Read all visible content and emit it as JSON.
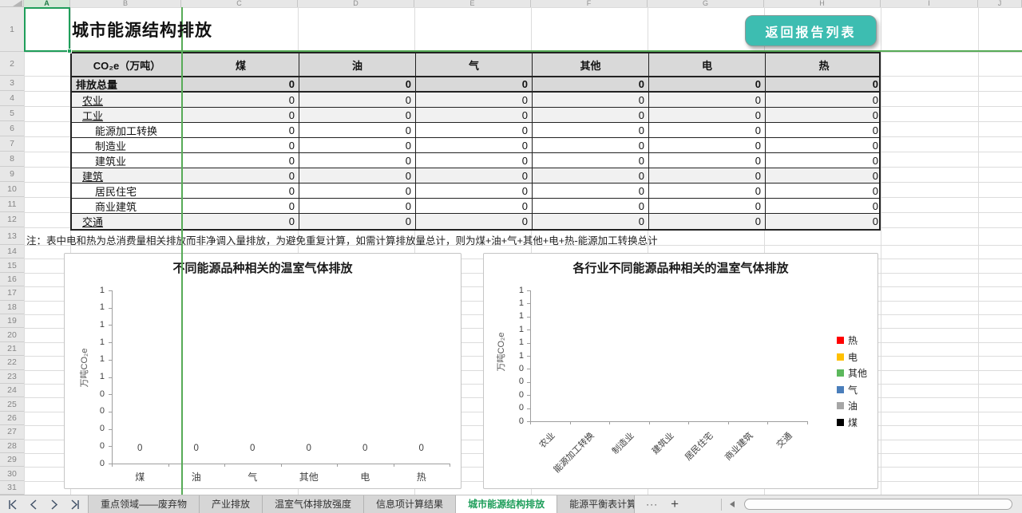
{
  "page": {
    "title": "城市能源结构排放",
    "return_button": "返回报告列表"
  },
  "spreadsheet": {
    "selected_cell": "A1",
    "column_letters": [
      "A",
      "B",
      "C",
      "D",
      "E",
      "F",
      "G",
      "H",
      "I",
      "J"
    ],
    "visible_rows": [
      "1",
      "2",
      "3",
      "4",
      "5",
      "6",
      "7",
      "8",
      "9",
      "10",
      "11",
      "12",
      "13",
      "14",
      "15",
      "16",
      "17",
      "18",
      "19",
      "20",
      "21",
      "22",
      "23",
      "24",
      "25",
      "26",
      "27",
      "28",
      "29",
      "30",
      "31"
    ]
  },
  "table": {
    "headers": [
      "CO₂e（万吨）",
      "煤",
      "油",
      "气",
      "其他",
      "电",
      "热"
    ],
    "rows": [
      {
        "label": "排放总量",
        "style": "total",
        "values": [
          "0",
          "0",
          "0",
          "0",
          "0",
          "0"
        ]
      },
      {
        "label": "农业",
        "style": "group",
        "values": [
          "0",
          "0",
          "0",
          "0",
          "0",
          "0"
        ]
      },
      {
        "label": "工业",
        "style": "group",
        "values": [
          "0",
          "0",
          "0",
          "0",
          "0",
          "0"
        ]
      },
      {
        "label": "能源加工转换",
        "style": "sub",
        "values": [
          "0",
          "0",
          "0",
          "0",
          "0",
          "0"
        ]
      },
      {
        "label": "制造业",
        "style": "sub",
        "values": [
          "0",
          "0",
          "0",
          "0",
          "0",
          "0"
        ]
      },
      {
        "label": "建筑业",
        "style": "sub",
        "values": [
          "0",
          "0",
          "0",
          "0",
          "0",
          "0"
        ]
      },
      {
        "label": "建筑",
        "style": "group",
        "values": [
          "0",
          "0",
          "0",
          "0",
          "0",
          "0"
        ]
      },
      {
        "label": "居民住宅",
        "style": "sub",
        "values": [
          "0",
          "0",
          "0",
          "0",
          "0",
          "0"
        ]
      },
      {
        "label": "商业建筑",
        "style": "sub",
        "values": [
          "0",
          "0",
          "0",
          "0",
          "0",
          "0"
        ]
      },
      {
        "label": "交通",
        "style": "group",
        "values": [
          "0",
          "0",
          "0",
          "0",
          "0",
          "0"
        ]
      }
    ],
    "note": "注：表中电和热为总消费量相关排放而非净调入量排放，为避免重复计算，如需计算排放量总计，则为煤+油+气+其他+电+热-能源加工转换总计"
  },
  "chart_data": [
    {
      "type": "bar",
      "title": "不同能源品种相关的温室气体排放",
      "categories": [
        "煤",
        "油",
        "气",
        "其他",
        "电",
        "热"
      ],
      "values": [
        0,
        0,
        0,
        0,
        0,
        0
      ],
      "data_labels": [
        "0",
        "0",
        "0",
        "0",
        "0",
        "0"
      ],
      "xlabel": "",
      "ylabel": "万吨CO₂e",
      "ylim": [
        0,
        1
      ],
      "ytick_labels": [
        "1",
        "1",
        "1",
        "1",
        "1",
        "1",
        "0",
        "0",
        "0",
        "0",
        "0"
      ],
      "grid": false,
      "legend": null
    },
    {
      "type": "bar",
      "stacked": true,
      "title": "各行业不同能源品种相关的温室气体排放",
      "categories": [
        "农业",
        "能源加工转换",
        "制造业",
        "建筑业",
        "居民住宅",
        "商业建筑",
        "交通"
      ],
      "series": [
        {
          "name": "煤",
          "color": "#000000",
          "values": [
            0,
            0,
            0,
            0,
            0,
            0,
            0
          ]
        },
        {
          "name": "油",
          "color": "#a6a6a6",
          "values": [
            0,
            0,
            0,
            0,
            0,
            0,
            0
          ]
        },
        {
          "name": "气",
          "color": "#4a7ebb",
          "values": [
            0,
            0,
            0,
            0,
            0,
            0,
            0
          ]
        },
        {
          "name": "其他",
          "color": "#5cb85c",
          "values": [
            0,
            0,
            0,
            0,
            0,
            0,
            0
          ]
        },
        {
          "name": "电",
          "color": "#ffc000",
          "values": [
            0,
            0,
            0,
            0,
            0,
            0,
            0
          ]
        },
        {
          "name": "热",
          "color": "#ff0000",
          "values": [
            0,
            0,
            0,
            0,
            0,
            0,
            0
          ]
        }
      ],
      "legend": [
        "热",
        "电",
        "其他",
        "气",
        "油",
        "煤"
      ],
      "legend_colors": [
        "#ff0000",
        "#ffc000",
        "#5cb85c",
        "#4a7ebb",
        "#a6a6a6",
        "#000000"
      ],
      "legend_position": "right",
      "xlabel": "",
      "ylabel": "万吨CO₂e",
      "ylim": [
        0,
        1
      ],
      "ytick_labels": [
        "1",
        "1",
        "1",
        "1",
        "1",
        "1",
        "0",
        "0",
        "0",
        "0",
        "0"
      ],
      "grid": false
    }
  ],
  "tab_bar": {
    "nav_icons": [
      "first-sheet",
      "previous-sheet",
      "next-sheet",
      "last-sheet"
    ],
    "tabs": [
      {
        "label": "重点领域——废弃物",
        "active": false
      },
      {
        "label": "产业排放",
        "active": false
      },
      {
        "label": "温室气体排放强度",
        "active": false
      },
      {
        "label": "信息项计算结果",
        "active": false
      },
      {
        "label": "城市能源结构排放",
        "active": true
      },
      {
        "label": "能源平衡表计算结",
        "active": false,
        "truncated": true
      }
    ],
    "more_label": "···",
    "add_label": "+"
  },
  "colors": {
    "selection_green": "#1f9e5a",
    "active_tab_green": "#1e9e5a",
    "button_teal": "#3dbdb1",
    "page_break_green": "#57ab57",
    "table_header_gray": "#d9d9d9",
    "group_row_gray": "#f1f1f1"
  }
}
